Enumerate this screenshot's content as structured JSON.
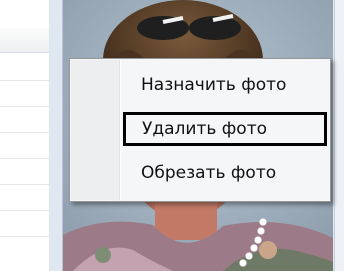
{
  "context_menu": {
    "items": [
      {
        "label": "Назначить фото",
        "highlighted": false
      },
      {
        "label": "Удалить фото",
        "highlighted": true
      },
      {
        "label": "Обрезать фото",
        "highlighted": false
      }
    ]
  },
  "colors": {
    "frame_background": "#dfe7f0",
    "menu_background": "#f5f6f7",
    "menu_border": "#979797",
    "highlight_border": "#000000"
  }
}
